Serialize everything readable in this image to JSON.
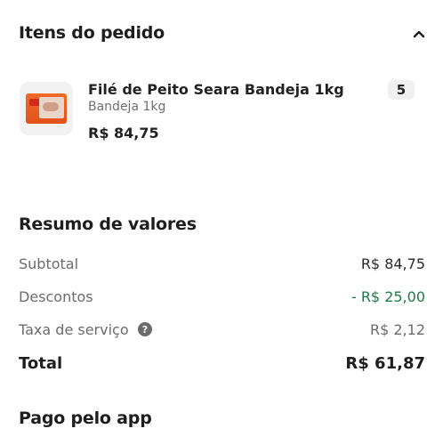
{
  "items_section": {
    "title": "Itens do pedido",
    "toggle_icon": "chevron-up-icon",
    "items": [
      {
        "name": "Filé de Peito Seara Bandeja 1kg",
        "variant": "Bandeja 1kg",
        "price": "R$ 84,75",
        "quantity": "5",
        "image_icon": "product-package-icon"
      }
    ]
  },
  "summary": {
    "title": "Resumo de valores",
    "subtotal_label": "Subtotal",
    "subtotal_value": "R$ 84,75",
    "discounts_label": "Descontos",
    "discounts_value": "- R$ 25,00",
    "service_fee_label": "Taxa de serviço",
    "service_fee_value": "R$ 2,12",
    "total_label": "Total",
    "total_value": "R$ 61,87"
  },
  "payment_section": {
    "title": "Pago pelo app"
  },
  "colors": {
    "discount_green": "#1f7a46",
    "muted_text": "#6b6b6b",
    "primary_text": "#1e1e1e"
  }
}
